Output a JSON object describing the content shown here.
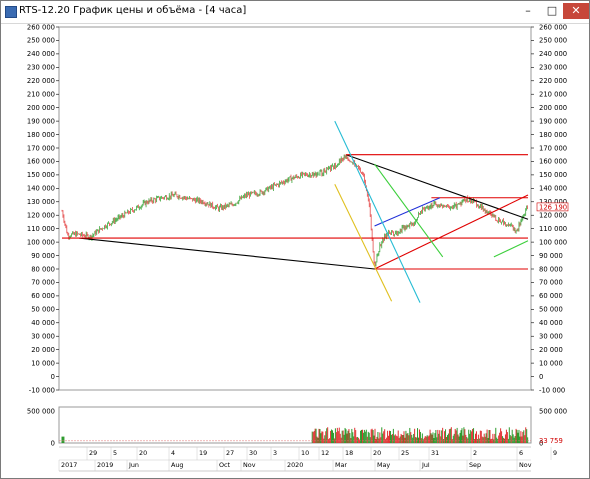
{
  "window": {
    "title": "RTS-12.20 График цены и объёма - [4 часа]",
    "controls": {
      "minimize": "–",
      "maximize": "□",
      "close": "✕"
    },
    "close_color": "#c7473a"
  },
  "chart_data": {
    "type": "candlestick",
    "price_axis": {
      "ticks": [
        "260 000",
        "250 000",
        "240 000",
        "230 000",
        "220 000",
        "210 000",
        "200 000",
        "190 000",
        "180 000",
        "170 000",
        "160 000",
        "150 000",
        "140 000",
        "130 000",
        "120 000",
        "110 000",
        "100 000",
        "90 000",
        "80 000",
        "70 000",
        "60 000",
        "50 000",
        "40 000",
        "30 000",
        "20 000",
        "10 000",
        "0",
        "-10 000"
      ],
      "values": [
        260000,
        250000,
        240000,
        230000,
        220000,
        210000,
        200000,
        190000,
        180000,
        170000,
        160000,
        150000,
        140000,
        130000,
        120000,
        110000,
        100000,
        90000,
        80000,
        70000,
        60000,
        50000,
        40000,
        30000,
        20000,
        10000,
        0,
        -10000
      ],
      "ylim": [
        -10000,
        260000
      ]
    },
    "last_price_label": "126 190",
    "last_price": 126190,
    "volume_axis": {
      "ticks": [
        "500 000",
        "0"
      ],
      "values": [
        500000,
        0
      ]
    },
    "last_volume_label": "33 759",
    "last_volume": 33759,
    "x_top_labels": [
      "29",
      "5",
      "20",
      "4",
      "19",
      "3",
      "18",
      "3",
      "18",
      "3",
      "18",
      "3",
      "18",
      "3",
      "18",
      "3",
      "18",
      "3",
      "18",
      "3"
    ],
    "x_row1": [
      "29",
      "5",
      "20",
      "4",
      "19",
      "27",
      "30",
      "3",
      "10",
      "12",
      "18",
      "20",
      "25",
      "31",
      "2",
      "6",
      "9"
    ],
    "x_row2": [
      "2017",
      "2019",
      "Jun",
      "Aug",
      "Oct",
      "Nov",
      "2020",
      "Mar",
      "May",
      "Jul",
      "Sep",
      "Nov"
    ],
    "price_path": [
      [
        0,
        123000
      ],
      [
        2,
        105000
      ],
      [
        5,
        106000
      ],
      [
        10,
        104000
      ],
      [
        15,
        112000
      ],
      [
        20,
        118000
      ],
      [
        25,
        124000
      ],
      [
        30,
        130000
      ],
      [
        35,
        133000
      ],
      [
        40,
        135000
      ],
      [
        45,
        132000
      ],
      [
        50,
        130000
      ],
      [
        55,
        125000
      ],
      [
        60,
        128000
      ],
      [
        65,
        135000
      ],
      [
        70,
        137000
      ],
      [
        75,
        142000
      ],
      [
        80,
        147000
      ],
      [
        85,
        150000
      ],
      [
        90,
        151000
      ],
      [
        95,
        155000
      ],
      [
        100,
        164000
      ],
      [
        103,
        158000
      ],
      [
        106,
        150000
      ],
      [
        108,
        130000
      ],
      [
        110,
        82000
      ],
      [
        112,
        98000
      ],
      [
        115,
        108000
      ],
      [
        118,
        107000
      ],
      [
        121,
        112000
      ],
      [
        124,
        115000
      ],
      [
        127,
        125000
      ],
      [
        130,
        128000
      ],
      [
        133,
        127000
      ],
      [
        136,
        126000
      ],
      [
        139,
        127000
      ],
      [
        142,
        132000
      ],
      [
        145,
        130000
      ],
      [
        148,
        125000
      ],
      [
        151,
        120000
      ],
      [
        154,
        116000
      ],
      [
        157,
        114000
      ],
      [
        160,
        108000
      ],
      [
        162,
        118000
      ],
      [
        164,
        126000
      ]
    ],
    "annotation_lines": [
      {
        "name": "black-lower-trend",
        "color": "#000000",
        "from": [
          6,
          103000
        ],
        "to": [
          110,
          80000
        ]
      },
      {
        "name": "black-upper-trend",
        "color": "#000000",
        "from": [
          100,
          165000
        ],
        "to": [
          164,
          117000
        ]
      },
      {
        "name": "red-horizontal-165k",
        "color": "#e00000",
        "from": [
          100,
          165000
        ],
        "to": [
          164,
          165000
        ]
      },
      {
        "name": "red-horizontal-133k",
        "color": "#e00000",
        "from": [
          130,
          133000
        ],
        "to": [
          164,
          133000
        ]
      },
      {
        "name": "red-horizontal-103k",
        "color": "#e00000",
        "from": [
          0,
          103000
        ],
        "to": [
          164,
          103000
        ]
      },
      {
        "name": "red-horizontal-80k",
        "color": "#e00000",
        "from": [
          110,
          80000
        ],
        "to": [
          164,
          80000
        ]
      },
      {
        "name": "red-rising-line",
        "color": "#e00000",
        "from": [
          110,
          80000
        ],
        "to": [
          164,
          135000
        ]
      },
      {
        "name": "blue-channel-line",
        "color": "#1f2fd8",
        "from": [
          110,
          112000
        ],
        "to": [
          133,
          133000
        ]
      },
      {
        "name": "cyan-fan-line",
        "color": "#26bcd4",
        "from": [
          96,
          190000
        ],
        "to": [
          126,
          55000
        ]
      },
      {
        "name": "yellow-fan-line",
        "color": "#e0c020",
        "from": [
          96,
          143000
        ],
        "to": [
          116,
          56000
        ]
      },
      {
        "name": "green-fan-line",
        "color": "#3ccf3c",
        "from": [
          110,
          158000
        ],
        "to": [
          134,
          89000
        ]
      },
      {
        "name": "green-short-line",
        "color": "#3ccf3c",
        "from": [
          152,
          89000
        ],
        "to": [
          164,
          101000
        ]
      }
    ]
  }
}
